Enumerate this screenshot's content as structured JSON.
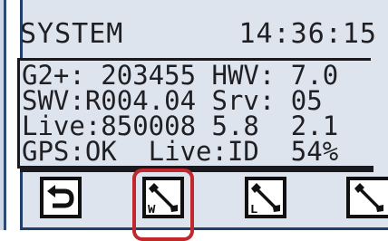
{
  "header": {
    "title": "SYSTEM",
    "clock": "14:36:15"
  },
  "info": {
    "lines": [
      "G2+: 203455 HWV: 7.0",
      "SWV:R004.04 Srv: 05",
      "Live:850008 5.8  2.1",
      "GPS:OK  Live:ID  54%"
    ]
  },
  "buttons": [
    {
      "icon": "back-arrow-icon"
    },
    {
      "icon": "wrench-icon",
      "letter": "W",
      "selected": true
    },
    {
      "icon": "wrench-icon",
      "letter": "L"
    },
    {
      "icon": "wrench-icon"
    }
  ],
  "colors": {
    "screen_bg": "#dde4ed",
    "frame": "#20406b",
    "text": "#1f1f24",
    "selection": "#c0282d"
  }
}
